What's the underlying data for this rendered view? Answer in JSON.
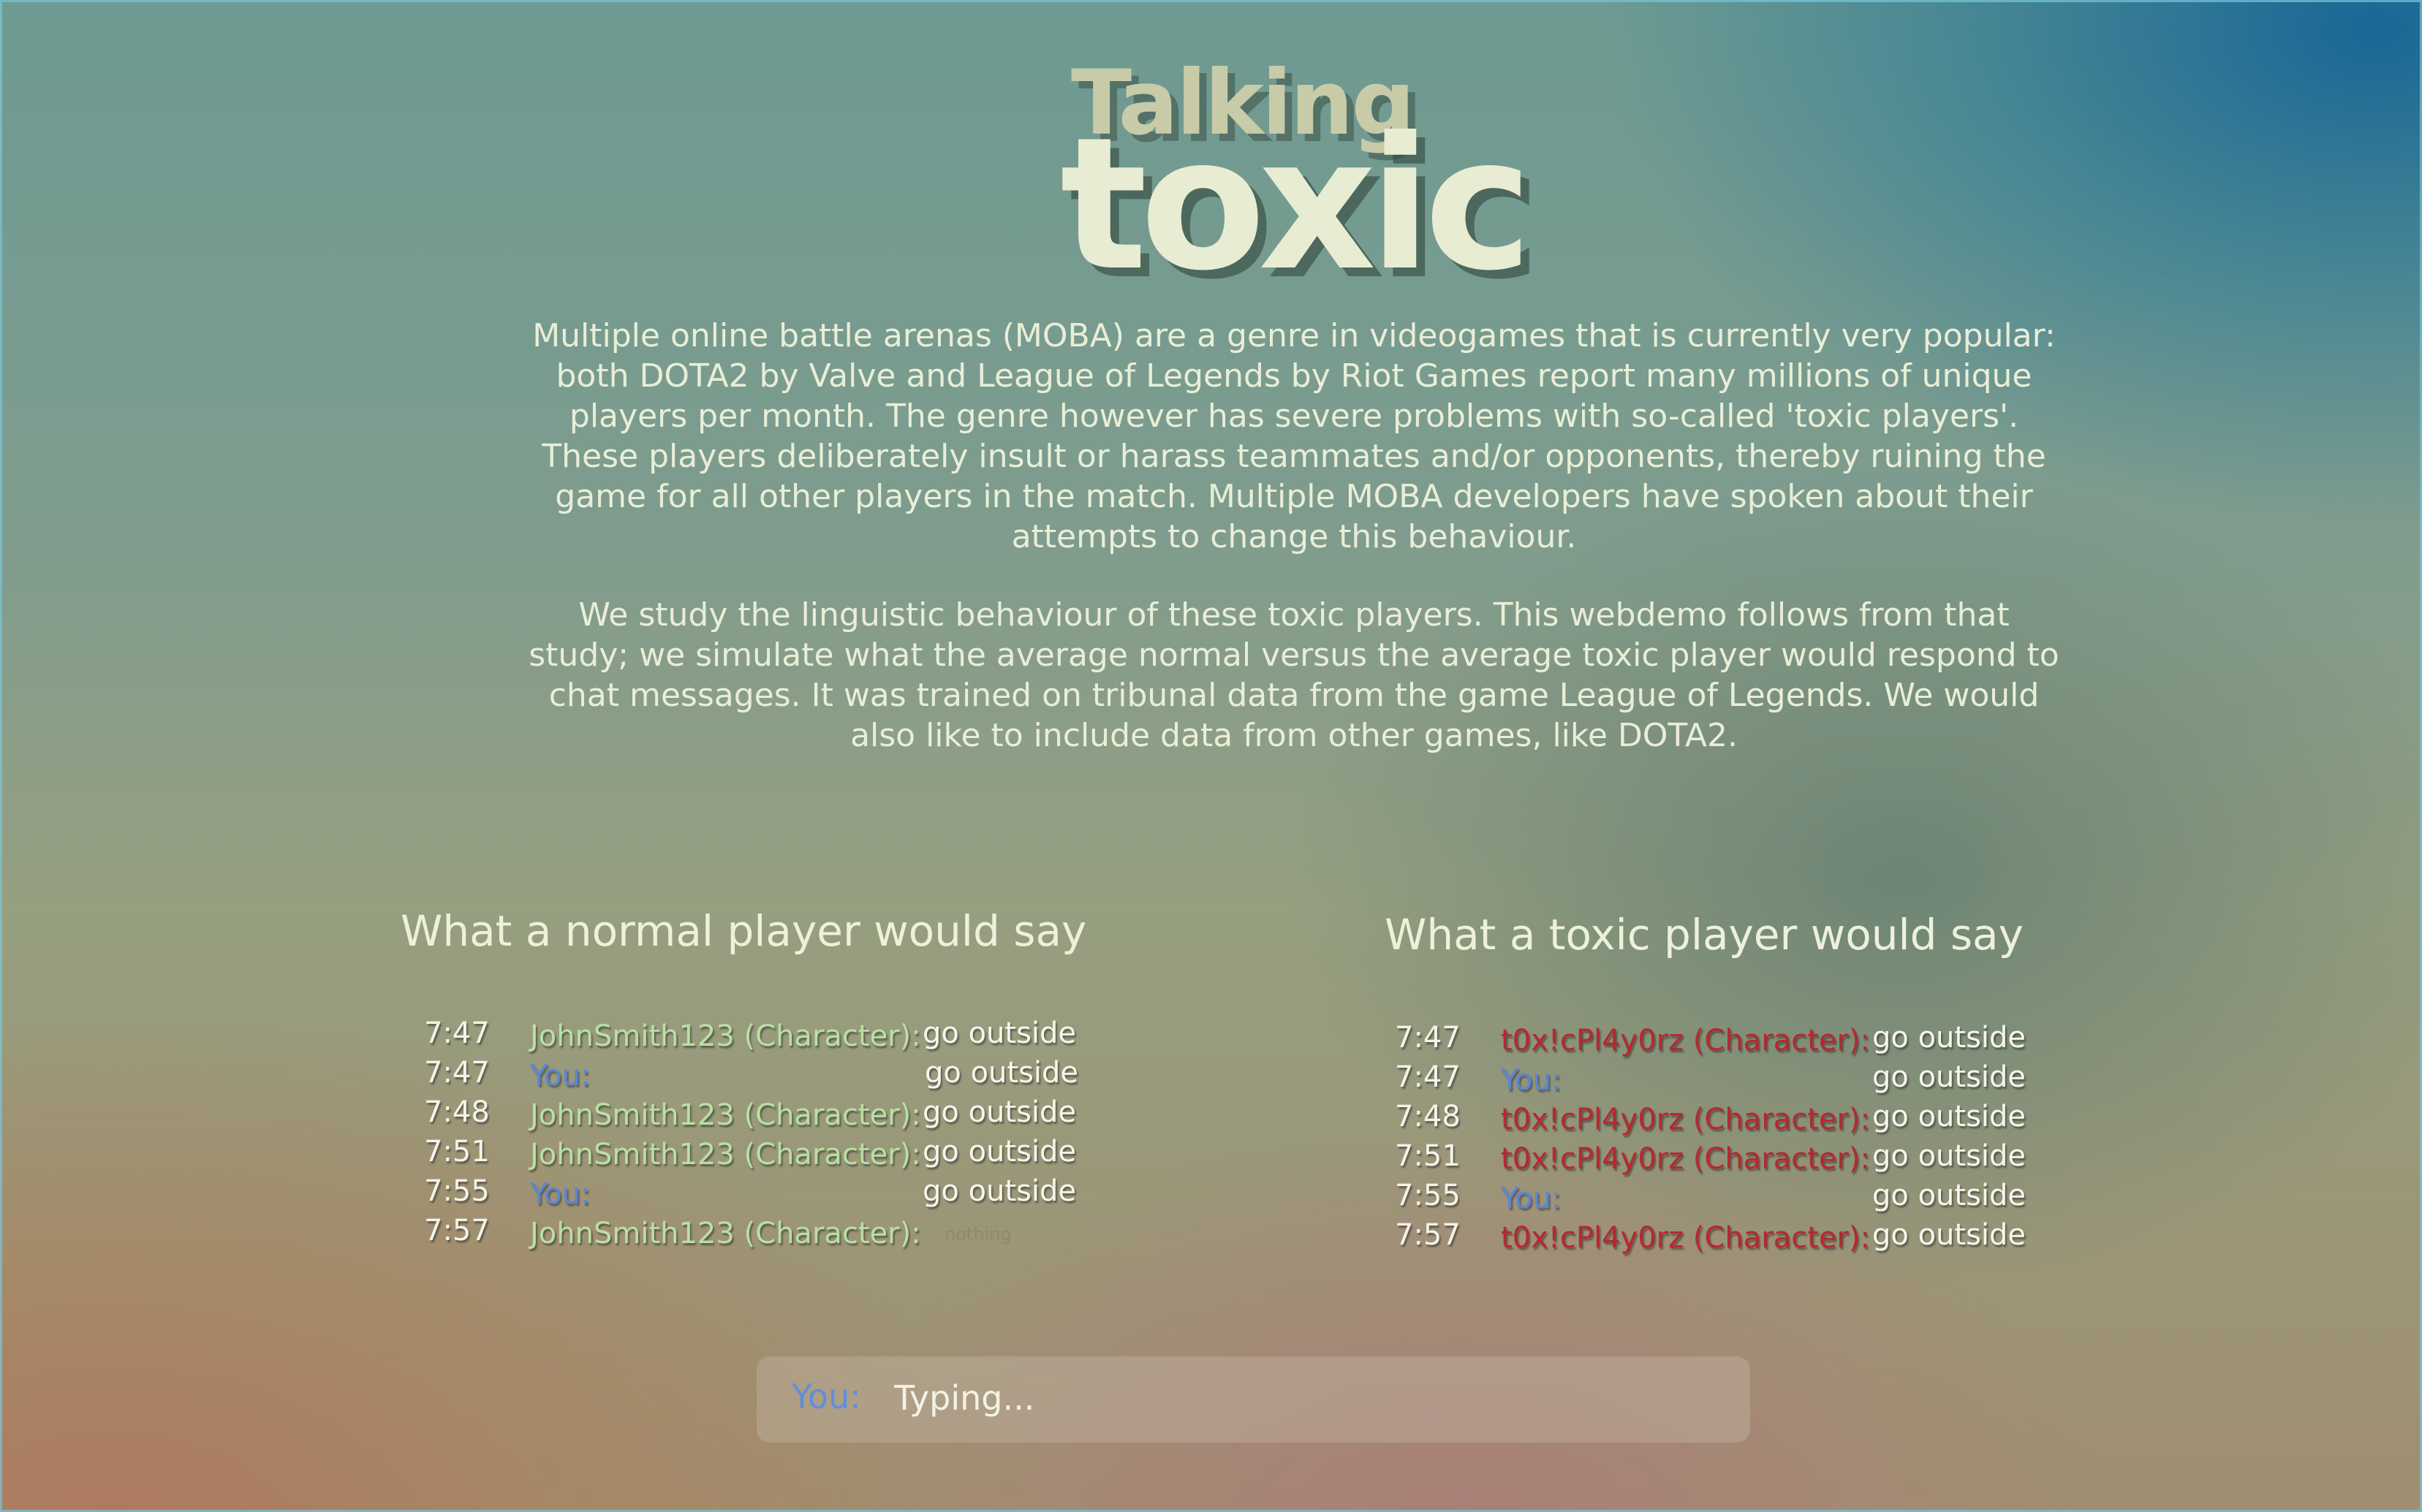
{
  "title": {
    "line1": "Talking",
    "line2": "toxic"
  },
  "intro": {
    "paragraph1": "Multiple online battle arenas (MOBA) are a genre in videogames that is currently very popular: both DOTA2 by Valve and League of Legends by Riot Games report many millions of unique players per month. The genre however has severe problems with so-called 'toxic players'. These players deliberately insult or harass teammates and/or opponents, thereby ruining the game for all other players in the match. Multiple MOBA developers have spoken about their attempts to change this behaviour.",
    "paragraph2": "We study the linguistic behaviour of these toxic players. This webdemo follows from that study; we simulate what the average normal versus the average toxic player would respond to chat messages. It was trained on tribunal data from the game League of Legends. We would also like to include data from other games, like DOTA2."
  },
  "normal_panel": {
    "heading": "What a normal player would say",
    "messages": [
      {
        "time": "7:47",
        "sender": "JohnSmith123 (Character):",
        "text": "go outside"
      },
      {
        "time": "7:47",
        "sender": "You:",
        "text": "go outside"
      },
      {
        "time": "7:48",
        "sender": "JohnSmith123 (Character):",
        "text": "go outside"
      },
      {
        "time": "7:51",
        "sender": "JohnSmith123 (Character):",
        "text": "go outside"
      },
      {
        "time": "7:55",
        "sender": "You:",
        "text": "go outside"
      },
      {
        "time": "7:57",
        "sender": "JohnSmith123 (Character):",
        "text": "nothing"
      }
    ]
  },
  "toxic_panel": {
    "heading": "What a toxic player would say",
    "messages": [
      {
        "time": "7:47",
        "sender": "t0x!cPl4y0rz (Character):",
        "text": "go outside"
      },
      {
        "time": "7:47",
        "sender": "You:",
        "text": "go outside"
      },
      {
        "time": "7:48",
        "sender": "t0x!cPl4y0rz (Character):",
        "text": "go outside"
      },
      {
        "time": "7:51",
        "sender": "t0x!cPl4y0rz (Character):",
        "text": "go outside"
      },
      {
        "time": "7:55",
        "sender": "You:",
        "text": "go outside"
      },
      {
        "time": "7:57",
        "sender": "t0x!cPl4y0rz (Character):",
        "text": "go outside"
      }
    ]
  },
  "input": {
    "label": "You:",
    "placeholder": "Typing..."
  },
  "colors": {
    "normal_sender": "#b9e0a2",
    "toxic_sender": "#b7282e",
    "you_sender": "#5a86d8",
    "text": "#e9eed6"
  }
}
